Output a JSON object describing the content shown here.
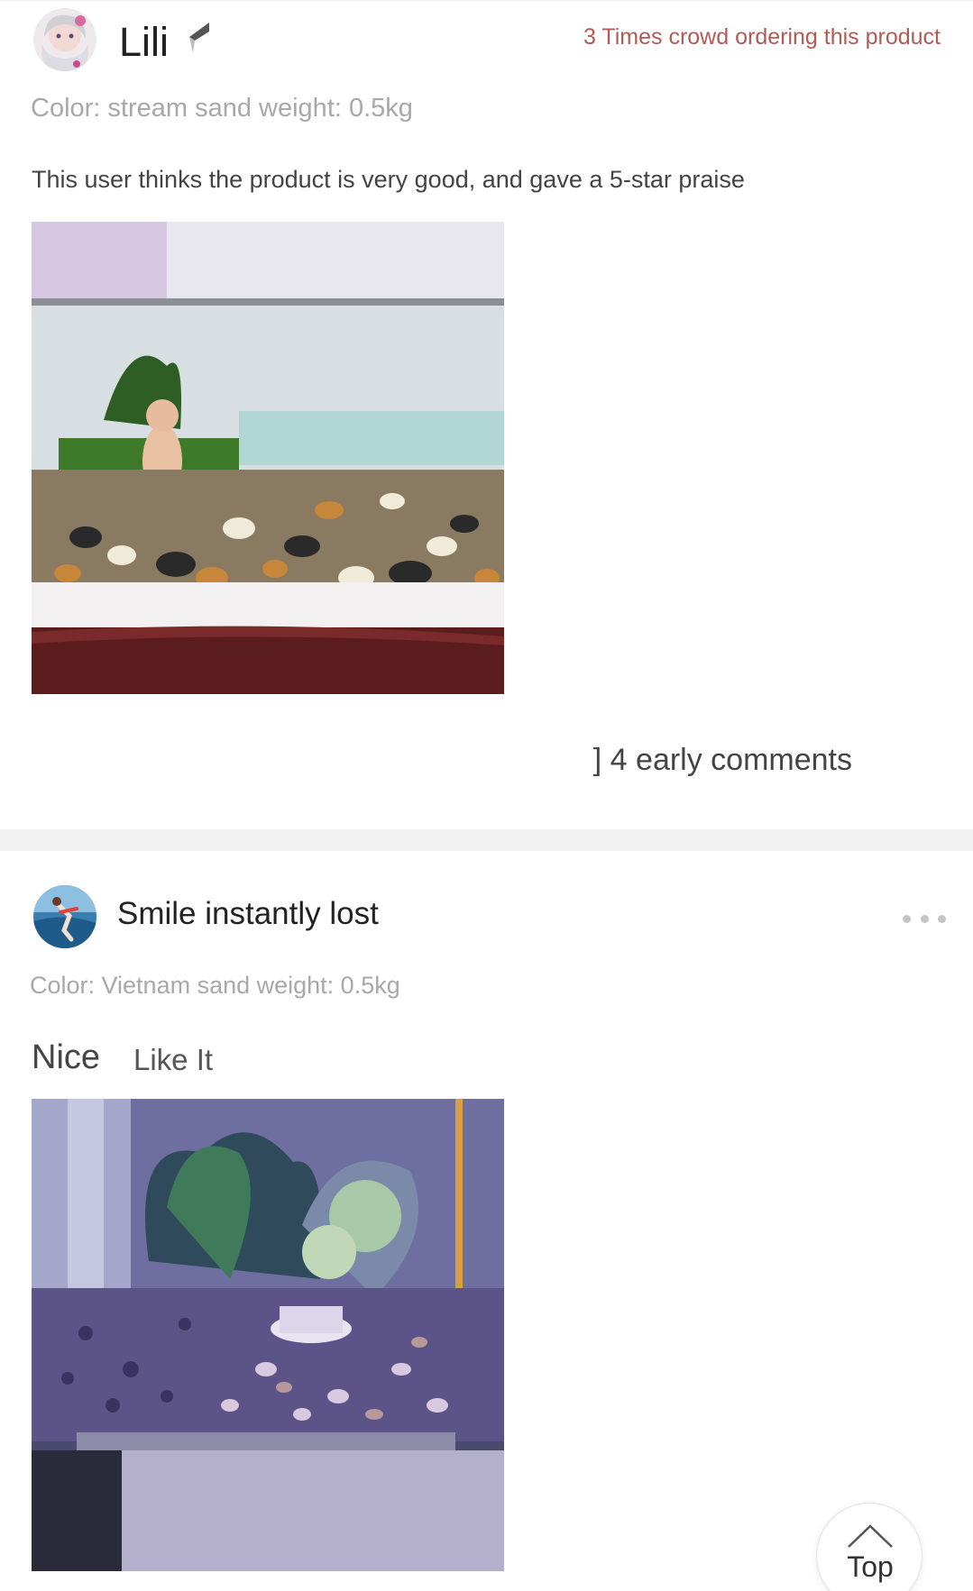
{
  "reviews": [
    {
      "username": "Lili",
      "crowd_text": "3 Times crowd ordering this product",
      "sku": "Color: stream sand weight: 0.5kg",
      "text": "This user thinks the product is very good, and gave a 5-star praise",
      "early_comments": "] 4 early comments"
    },
    {
      "username": "Smile instantly lost",
      "sku": "Color: Vietnam sand weight: 0.5kg",
      "text_main": "Nice",
      "text_tag": "Like It"
    }
  ],
  "top_button": {
    "label": "Top"
  },
  "colors": {
    "crowd_text": "#b25a55",
    "sku_text": "#a8a8a8",
    "divider": "#f1f1f1"
  }
}
